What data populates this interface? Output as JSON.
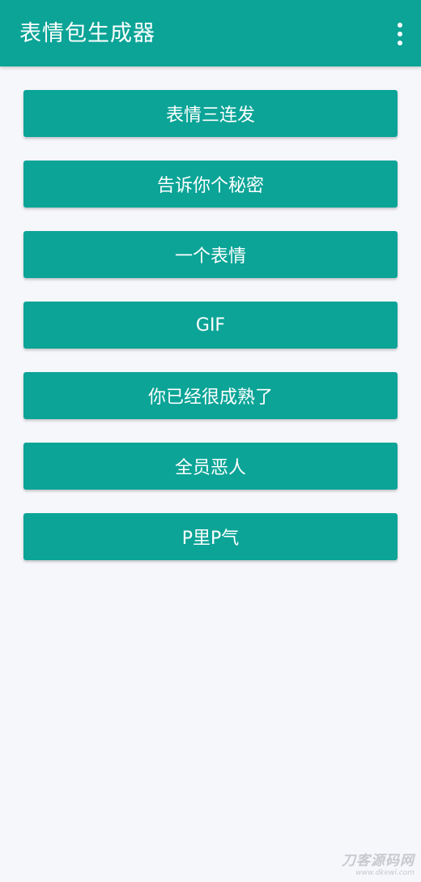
{
  "app_bar": {
    "title": "表情包生成器",
    "menu_icon": "more-vert-icon",
    "color": "#0ba497"
  },
  "buttons": [
    {
      "label": "表情三连发"
    },
    {
      "label": "告诉你个秘密"
    },
    {
      "label": "一个表情"
    },
    {
      "label": "GIF"
    },
    {
      "label": "你已经很成熟了"
    },
    {
      "label": "全员恶人"
    },
    {
      "label": "P里P气"
    }
  ],
  "watermark": {
    "name": "刀客源码网",
    "url": "www.dkewl.com"
  },
  "colors": {
    "accent": "#0ba497",
    "background": "#f6f7fb",
    "button_text": "#ffffff"
  }
}
